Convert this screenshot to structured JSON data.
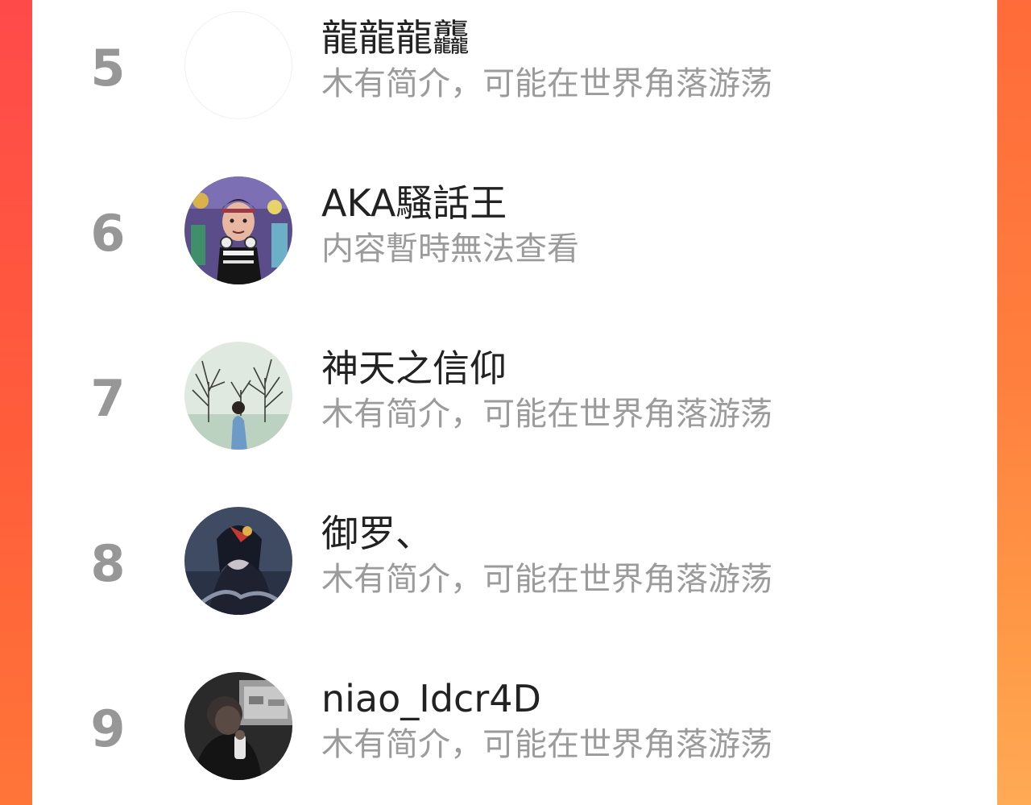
{
  "theme": {
    "accent_gradient": [
      "#ff4b47",
      "#ff7a3a",
      "#ffaa55"
    ],
    "card_background": "#ffffff",
    "rank_color": "#979797",
    "name_color": "#222222",
    "bio_color": "#9b9b9b"
  },
  "rows": [
    {
      "rank": "5",
      "name": "龍龍龍龘",
      "bio": "木有简介，可能在世界角落游荡",
      "avatar": "blank-avatar"
    },
    {
      "rank": "6",
      "name": "AKA騷話王",
      "bio": "内容暫時無法查看",
      "avatar": "anime-character-avatar"
    },
    {
      "rank": "7",
      "name": "神天之信仰",
      "bio": "木有简介，可能在世界角落游荡",
      "avatar": "trees-person-avatar"
    },
    {
      "rank": "8",
      "name": "御罗、",
      "bio": "木有简介，可能在世界角落游荡",
      "avatar": "dark-character-avatar"
    },
    {
      "rank": "9",
      "name": "niao_Idcr4D",
      "bio": "木有简介，可能在世界角落游荡",
      "avatar": "car-person-avatar"
    }
  ]
}
